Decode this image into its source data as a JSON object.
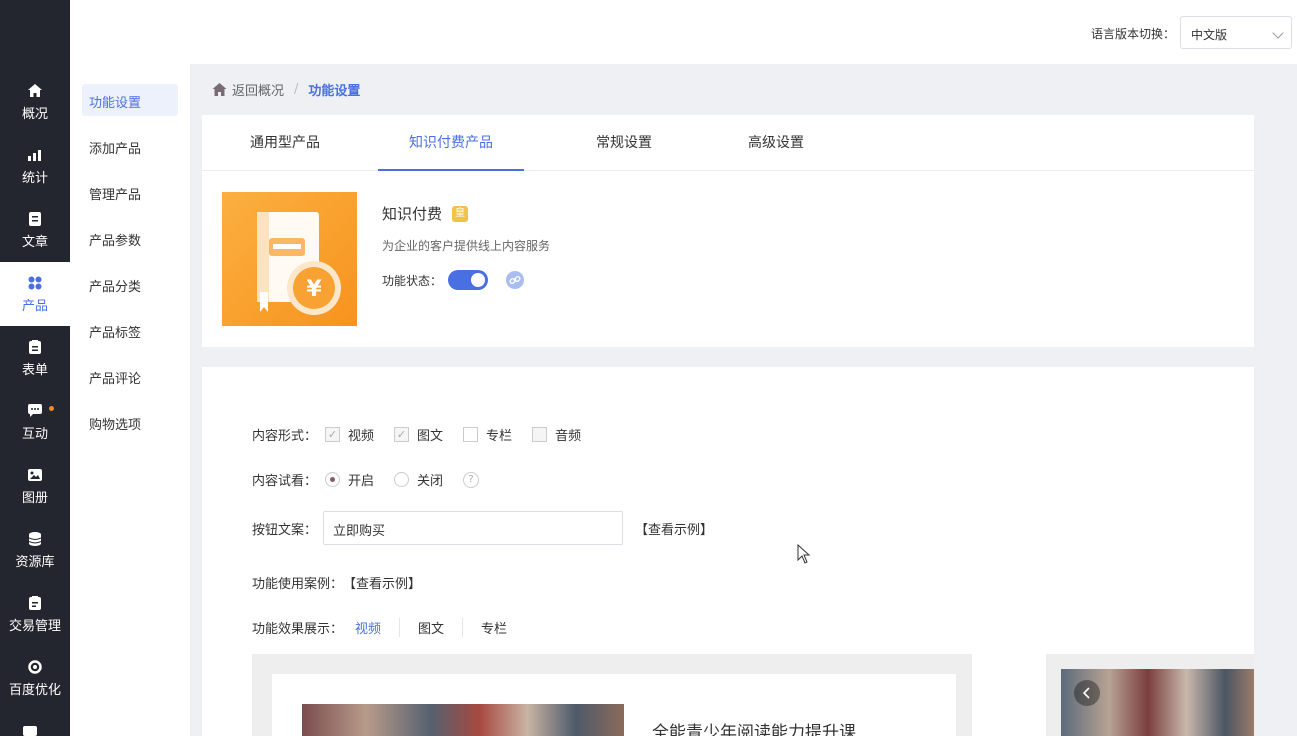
{
  "nav": {
    "items": [
      {
        "label": "概况",
        "icon": "home-icon"
      },
      {
        "label": "统计",
        "icon": "stats-icon"
      },
      {
        "label": "文章",
        "icon": "article-icon"
      },
      {
        "label": "产品",
        "icon": "product-icon",
        "active": true
      },
      {
        "label": "表单",
        "icon": "form-icon"
      },
      {
        "label": "互动",
        "icon": "chat-icon",
        "badge": true
      },
      {
        "label": "图册",
        "icon": "album-icon"
      },
      {
        "label": "资源库",
        "icon": "database-icon"
      },
      {
        "label": "交易管理",
        "icon": "trade-icon"
      },
      {
        "label": "百度优化",
        "icon": "seo-icon"
      }
    ]
  },
  "topbar": {
    "lang_label": "语言版本切换：",
    "lang_value": "中文版"
  },
  "submenu": {
    "items": [
      "功能设置",
      "添加产品",
      "管理产品",
      "产品参数",
      "产品分类",
      "产品标签",
      "产品评论",
      "购物选项"
    ]
  },
  "breadcrumb": {
    "back": "返回概况",
    "sep": "/",
    "current": "功能设置"
  },
  "tabs": [
    "通用型产品",
    "知识付费产品",
    "常规设置",
    "高级设置"
  ],
  "feature": {
    "title": "知识付费",
    "badge": "皇",
    "desc": "为企业的客户提供线上内容服务",
    "status_label": "功能状态：",
    "enabled": true
  },
  "settings": {
    "content_form_label": "内容形式：",
    "content_forms": [
      {
        "label": "视频",
        "checked": true
      },
      {
        "label": "图文",
        "checked": true
      },
      {
        "label": "专栏",
        "checked": false
      },
      {
        "label": "音频",
        "checked": false
      }
    ],
    "trial_label": "内容试看：",
    "trial_on": "开启",
    "trial_off": "关闭",
    "help": "?",
    "button_text_label": "按钮文案：",
    "button_text_value": "立即购买",
    "view_example": "【查看示例】",
    "case_label": "功能使用案例：",
    "effect_label": "功能效果展示：",
    "effect_tabs": [
      "视频",
      "图文",
      "专栏"
    ]
  },
  "preview": {
    "title": "全能青少年阅读能力提升课"
  },
  "colors": {
    "accent": "#4a6fe3",
    "nav_bg": "#23262e",
    "cover_orange": "#f7931e"
  }
}
